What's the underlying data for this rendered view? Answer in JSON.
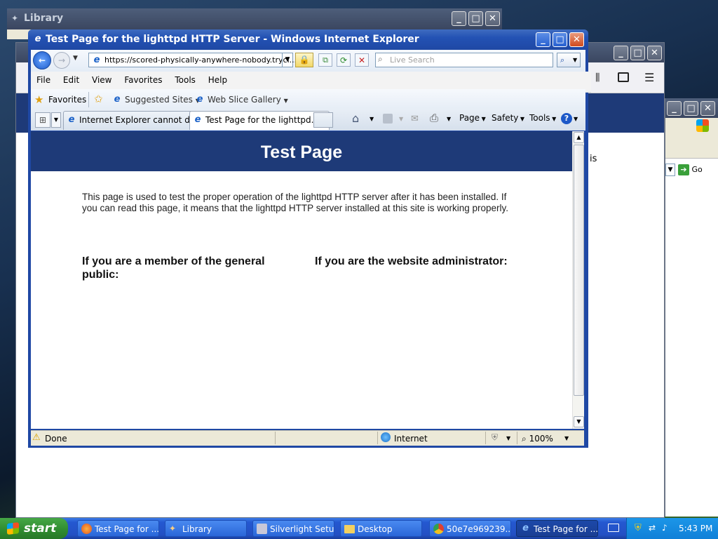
{
  "bg_windows": {
    "library_title": "Library",
    "right_partial_text": "is",
    "go_label": "Go"
  },
  "ie": {
    "title": "Test Page for the lighttpd HTTP Server - Windows Internet Explorer",
    "address": "https://scored-physically-anywhere-nobody.trycl...",
    "search_placeholder": "Live Search",
    "menu": [
      "File",
      "Edit",
      "View",
      "Favorites",
      "Tools",
      "Help"
    ],
    "favorites_label": "Favorites",
    "suggested_sites": "Suggested Sites",
    "web_slice_gallery": "Web Slice Gallery",
    "tabs": [
      {
        "label": "Internet Explorer cannot dis..."
      },
      {
        "label": "Test Page for the lighttpd..."
      }
    ],
    "cmd": {
      "page": "Page",
      "safety": "Safety",
      "tools": "Tools"
    },
    "status": {
      "text": "Done",
      "zone": "Internet",
      "zoom": "100%"
    }
  },
  "page": {
    "heading": "Test Page",
    "intro": "This page is used to test the proper operation of the lighttpd HTTP server after it has been installed. If you can read this page, it means that the lighttpd HTTP server installed at this site is working properly.",
    "col_left": "If you are a member of the general public:",
    "col_right": "If you are the website administrator:",
    "header_color": "#1e3a78"
  },
  "taskbar": {
    "start": "start",
    "buttons": [
      {
        "label": "Test Page for ...",
        "icon": "firefox-icon"
      },
      {
        "label": "Library",
        "icon": "library-icon"
      },
      {
        "label": "Silverlight Setup",
        "icon": "setup-icon"
      },
      {
        "label": "Desktop",
        "icon": "folder-icon"
      },
      {
        "label": "50e7e969239...",
        "icon": "chrome-icon"
      },
      {
        "label": "Test Page for ...",
        "icon": "ie-icon"
      }
    ],
    "clock": "5:43 PM"
  }
}
